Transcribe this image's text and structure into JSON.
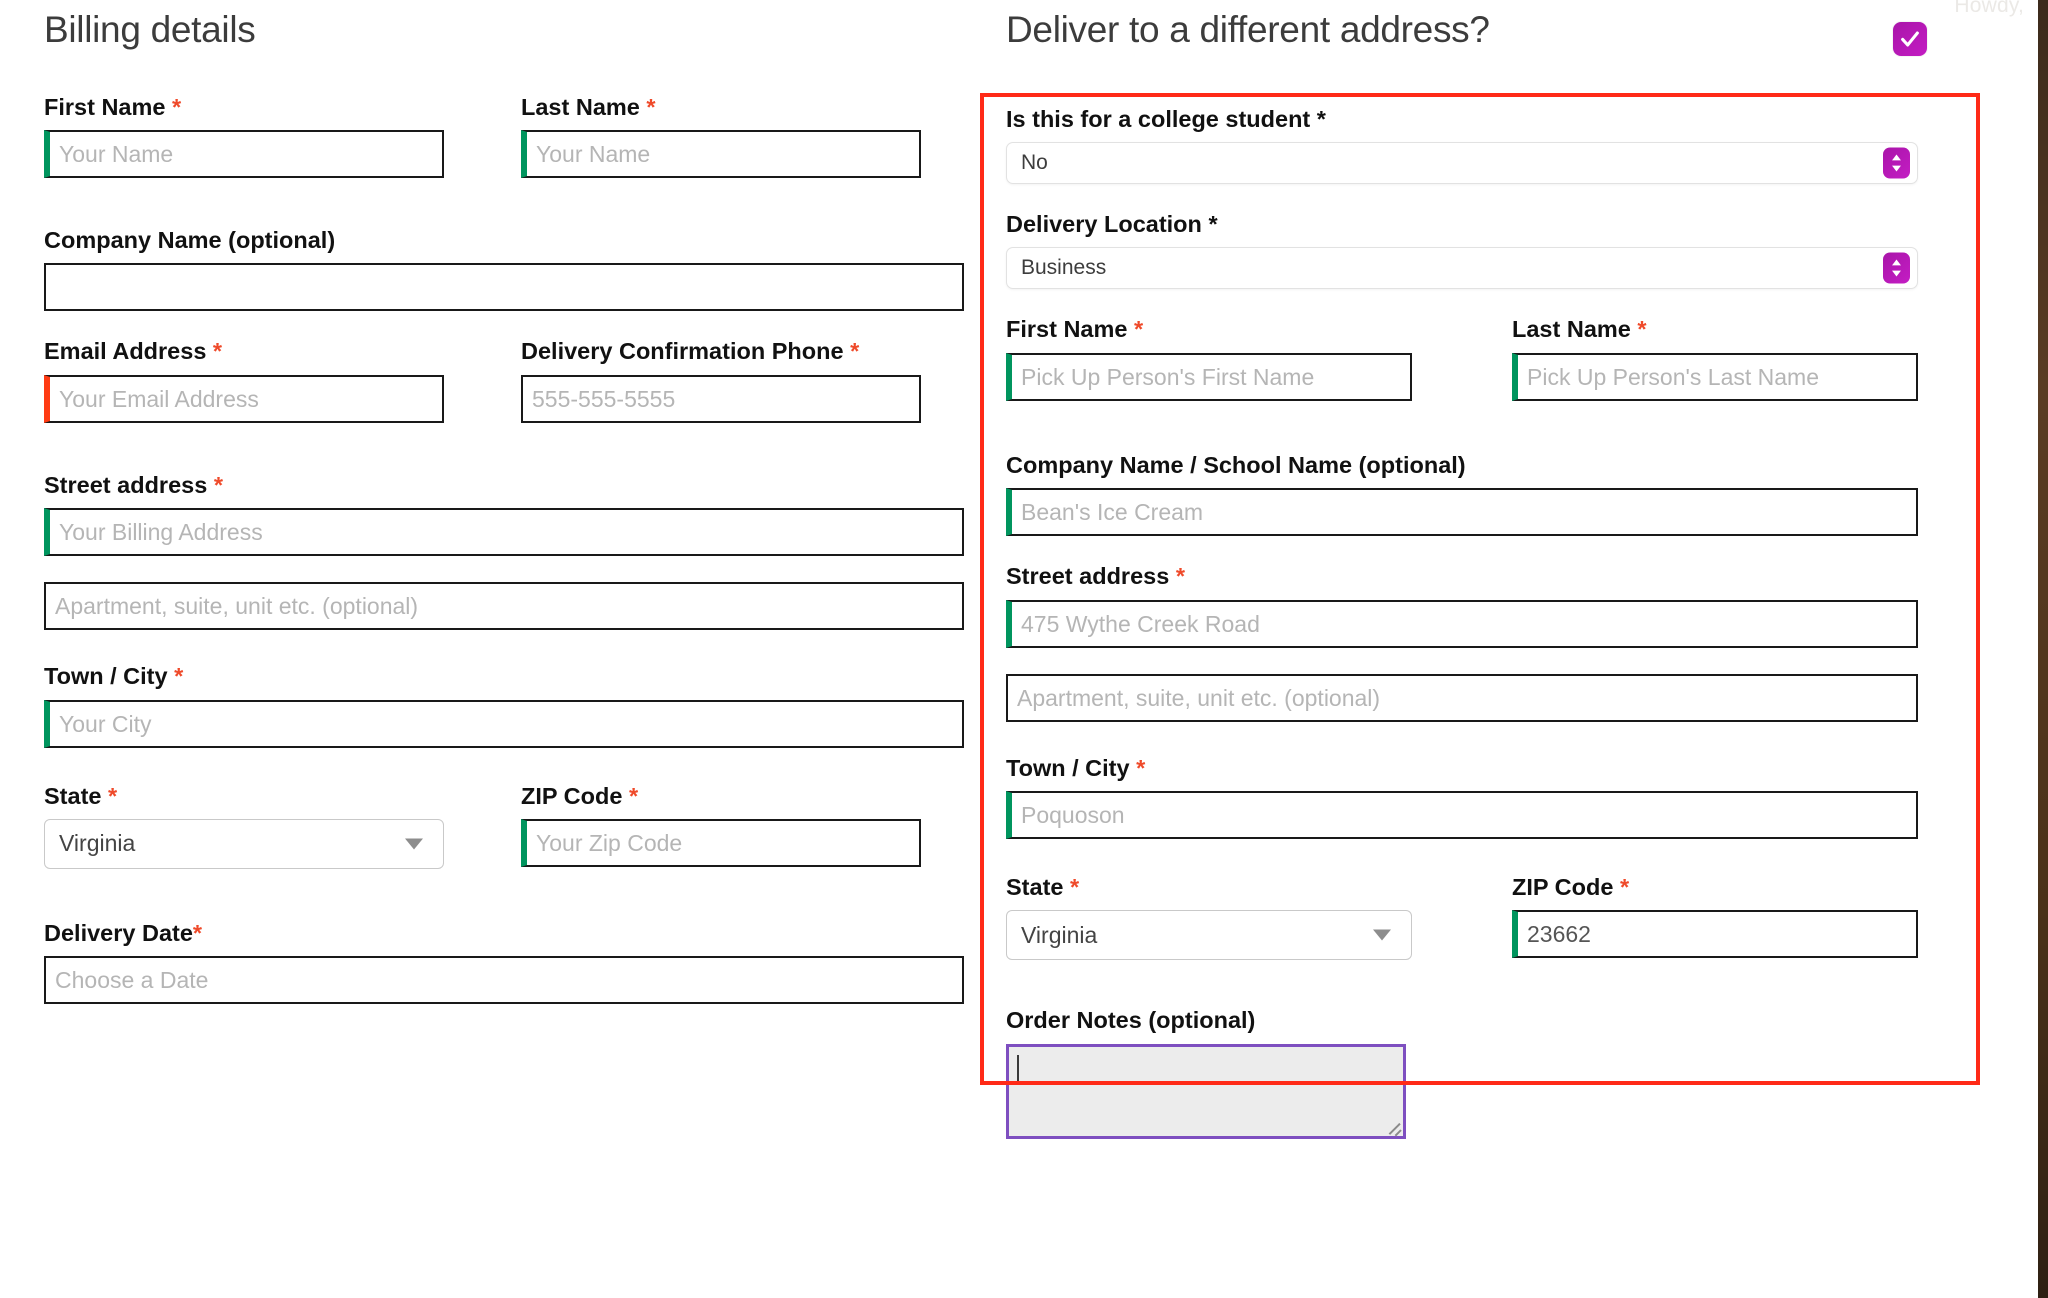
{
  "admin_bar": {
    "greeting": "Howdy,"
  },
  "billing": {
    "title": "Billing details",
    "fields": {
      "first_name": {
        "label": "First Name",
        "required": "*",
        "placeholder": "Your Name"
      },
      "last_name": {
        "label": "Last Name",
        "required": "*",
        "placeholder": "Your Name"
      },
      "company": {
        "label": "Company Name (optional)",
        "placeholder": ""
      },
      "email": {
        "label": "Email Address",
        "required": "*",
        "placeholder": "Your Email Address"
      },
      "phone": {
        "label": "Delivery Confirmation Phone",
        "required": "*",
        "placeholder": "555-555-5555"
      },
      "street": {
        "label": "Street address",
        "required": "*",
        "placeholder": "Your Billing Address"
      },
      "apartment": {
        "label": "",
        "placeholder": "Apartment, suite, unit etc. (optional)"
      },
      "city": {
        "label": "Town / City",
        "required": "*",
        "placeholder": "Your City"
      },
      "state": {
        "label": "State",
        "required": "*",
        "value": "Virginia"
      },
      "zip": {
        "label": "ZIP Code",
        "required": "*",
        "placeholder": "Your Zip Code"
      },
      "delivery_date": {
        "label": "Delivery Date",
        "required": "*",
        "placeholder": "Choose a Date"
      }
    }
  },
  "shipping": {
    "title": "Deliver to a different address?",
    "checkbox_checked": true,
    "fields": {
      "college_student": {
        "label": "Is this for a college student",
        "required": "*",
        "value": "No"
      },
      "delivery_location": {
        "label": "Delivery Location",
        "required": "*",
        "value": "Business"
      },
      "first_name": {
        "label": "First Name",
        "required": "*",
        "placeholder": "Pick Up Person's First Name"
      },
      "last_name": {
        "label": "Last Name",
        "required": "*",
        "placeholder": "Pick Up Person's Last Name"
      },
      "company": {
        "label": "Company Name / School Name (optional)",
        "placeholder": "Bean's Ice Cream"
      },
      "street": {
        "label": "Street address",
        "required": "*",
        "placeholder": "475 Wythe Creek Road"
      },
      "apartment": {
        "label": "",
        "placeholder": "Apartment, suite, unit etc. (optional)"
      },
      "city": {
        "label": "Town / City",
        "required": "*",
        "placeholder": "Poquoson"
      },
      "state": {
        "label": "State",
        "required": "*",
        "value": "Virginia"
      },
      "zip": {
        "label": "ZIP Code",
        "required": "*",
        "placeholder": "23662"
      }
    },
    "order_notes": {
      "label": "Order Notes (optional)",
      "value": ""
    }
  },
  "colors": {
    "accent_purple": "#b317b3",
    "highlight_red": "#ff2a17",
    "valid_green": "#00955e",
    "invalid_red": "#ff3b13",
    "required_star": "#ef4a2a",
    "textarea_focus": "#7e4fc0"
  }
}
